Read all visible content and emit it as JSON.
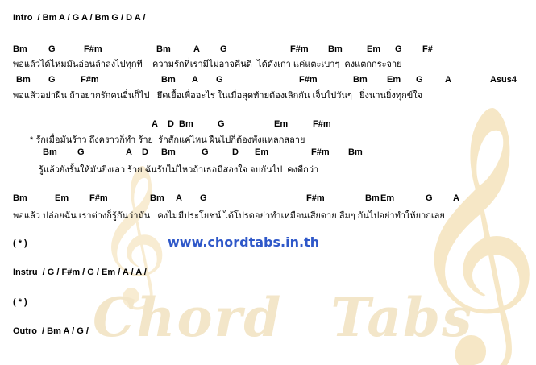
{
  "watermark": {
    "url": "www.chordtabs.in.th",
    "script_left": "Chord",
    "script_right": "Tabs",
    "clef_glyph": "𝄞"
  },
  "sections": {
    "intro": "Intro  / Bm A / G A / Bm G / D A /",
    "chorus_marker_1": "( * )",
    "instru": "Instru  / G / F#m / G / Em / A / A /",
    "chorus_marker_2": "( * )",
    "outro": "Outro  / Bm A / G /"
  },
  "verse1": {
    "chords_1": [
      "Bm",
      "G",
      "F#m",
      "Bm",
      "A",
      "G",
      "F#m",
      "Bm",
      "Em",
      "G",
      "F#"
    ],
    "lyric_1": "พอแล้วได้ไหมมันอ่อนล้าลงไปทุกที    ความรักที่เรามีไม่อาจคืนดี  ได้ดังเก่า แค่แตะเบาๆ  คงแตกกระจาย",
    "chords_2": [
      "Bm",
      "G",
      "F#m",
      "Bm",
      "A",
      "G",
      "F#m",
      "Bm",
      "Em",
      "G",
      "A",
      "Asus4"
    ],
    "lyric_2": "พอแล้วอย่าฝืน ถ้าอยากรักคนอื่นก็ไป   ยึดเยื้อเพื่ออะไร ในเมื่อสุดท้ายต้องเลิกกัน เจ็บไปวันๆ   ยิ่งนานยิ่งทุกข์ใจ"
  },
  "chorus": {
    "chords_1": [
      "A",
      "D",
      "Bm",
      "G",
      "Em",
      "F#m"
    ],
    "lyric_1": "* รักเมื่อมันร้าว ถึงคราวก็ทำ ร้าย  รักสักแค่ไหน ฝืนไปก็ต้องพังแหลกสลาย",
    "chords_2": [
      "Bm",
      "G",
      "A",
      "D",
      "Bm",
      "G",
      "D",
      "Em",
      "F#m",
      "Bm"
    ],
    "lyric_2": "รู้แล้วยังรั้นให้มันยิ่งเลว ร้าย ฉันรับไม่ไหวถ้าเธอมีสองใจ จบกันไป  คงดีกว่า"
  },
  "verse2": {
    "chords_1": [
      "Bm",
      "Em",
      "F#m",
      "Bm",
      "A",
      "G",
      "F#m",
      "Bm",
      "Em",
      "G",
      "A"
    ],
    "lyric_1": "พอแล้ว ปล่อยฉัน เราต่างก็รู้กันว่ามัน   คงไม่มีประโยชน์ ได้โปรดอย่าทำเหมือนเสียดาย ลืมๆ กันไปอย่าทำให้ยากเลย"
  }
}
